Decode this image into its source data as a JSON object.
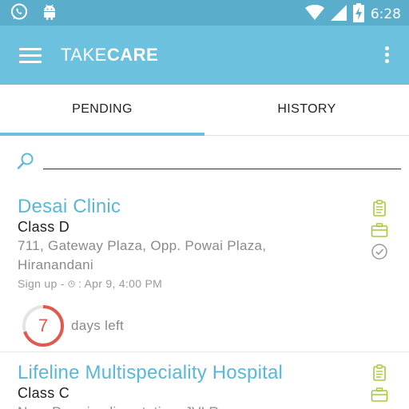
{
  "status_bar": {
    "time": "6:28",
    "icons": [
      "whatsapp-icon",
      "android-icon",
      "wifi-icon",
      "signal-icon",
      "battery-charging-icon"
    ]
  },
  "app_bar": {
    "title_light": "TAKE",
    "title_bold": "CARE",
    "icons": [
      "menu-icon",
      "overflow-menu-icon"
    ]
  },
  "tabs": [
    {
      "label": "PENDING",
      "selected": true
    },
    {
      "label": "HISTORY",
      "selected": false
    }
  ],
  "search": {
    "value": "",
    "placeholder": "",
    "icon": "search-icon"
  },
  "colors": {
    "primary": "#6cc1df",
    "status_bar": "#5aaecb",
    "accent_text": "#5ab7d9",
    "action_green": "#a6c93a",
    "countdown_red": "#e05a50"
  },
  "facilities": [
    {
      "name": "Desai Clinic",
      "class": "Class D",
      "address": "711, Gateway Plaza, Opp. Powai Plaza, Hiranandani",
      "signup_prefix": "Sign up - ",
      "signup_date": ": Apr 9, 4:00 PM",
      "days": "7",
      "days_label": "days left",
      "countdown_fraction": 0.7,
      "actions": [
        "clipboard-icon",
        "briefcase-icon",
        "check-circle-icon"
      ]
    },
    {
      "name": "Lifeline Multispeciality Hospital",
      "class": "Class C",
      "address": "Near Powai police station, JVLR",
      "actions": [
        "clipboard-icon",
        "briefcase-icon"
      ]
    }
  ]
}
